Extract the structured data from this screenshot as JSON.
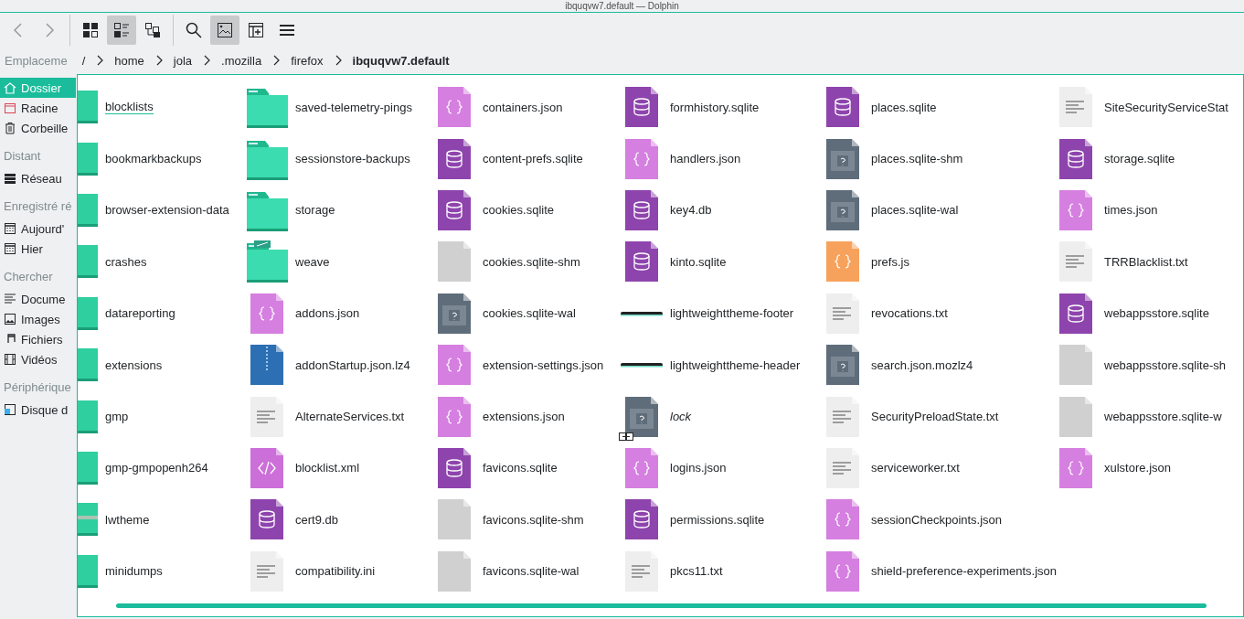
{
  "window": {
    "title": "ibquqvw7.default — Dolphin"
  },
  "toolbar": [
    {
      "kind": "back",
      "selected": false
    },
    {
      "kind": "forward",
      "selected": false
    },
    {
      "kind": "icons",
      "selected": false
    },
    {
      "kind": "compact",
      "selected": true
    },
    {
      "kind": "details",
      "selected": false
    },
    {
      "kind": "search",
      "selected": false
    },
    {
      "kind": "preview",
      "selected": true
    },
    {
      "kind": "split",
      "selected": false
    },
    {
      "kind": "menu",
      "selected": false
    }
  ],
  "breadcrumb": {
    "label": "Emplaceme",
    "parts": [
      {
        "text": "/",
        "current": false
      },
      {
        "text": "home",
        "current": false
      },
      {
        "text": "jola",
        "current": false
      },
      {
        "text": ".mozilla",
        "current": false
      },
      {
        "text": "firefox",
        "current": false
      },
      {
        "text": "ibquqvw7.default",
        "current": true
      }
    ]
  },
  "sidebar": [
    {
      "items": [
        {
          "label": "Dossier",
          "selected": true
        },
        {
          "label": "Racine",
          "selected": false
        },
        {
          "label": "Corbeille",
          "selected": false
        }
      ]
    },
    {
      "section": "Distant",
      "items": [
        {
          "label": "Réseau",
          "selected": false
        }
      ]
    },
    {
      "section": "Enregistré ré",
      "items": [
        {
          "label": "Aujourd'",
          "selected": false
        },
        {
          "label": "Hier",
          "selected": false
        }
      ]
    },
    {
      "section": "Chercher",
      "items": [
        {
          "label": "Docume",
          "selected": false
        },
        {
          "label": "Images",
          "selected": false
        },
        {
          "label": "Fichiers",
          "selected": false
        },
        {
          "label": "Vidéos",
          "selected": false
        }
      ]
    },
    {
      "section": "Périphérique",
      "items": [
        {
          "label": "Disque d",
          "selected": false
        }
      ]
    }
  ],
  "files": [
    {
      "name": "blocklists",
      "kind": "folder-cut",
      "hovered": true,
      "symlink": false
    },
    {
      "name": "bookmarkbackups",
      "kind": "folder-cut",
      "hovered": false,
      "symlink": false
    },
    {
      "name": "browser-extension-data",
      "kind": "folder-cut",
      "hovered": false,
      "symlink": false
    },
    {
      "name": "crashes",
      "kind": "folder-cut",
      "hovered": false,
      "symlink": false
    },
    {
      "name": "datareporting",
      "kind": "folder-cut",
      "hovered": false,
      "symlink": false
    },
    {
      "name": "extensions",
      "kind": "folder-cut",
      "hovered": false,
      "symlink": false
    },
    {
      "name": "gmp",
      "kind": "folder-cut",
      "hovered": false,
      "symlink": false
    },
    {
      "name": "gmp-gmpopenh264",
      "kind": "folder-cut",
      "hovered": false,
      "symlink": false
    },
    {
      "name": "lwtheme",
      "kind": "strip-folder",
      "hovered": false,
      "symlink": false
    },
    {
      "name": "minidumps",
      "kind": "folder-cut",
      "hovered": false,
      "symlink": false
    },
    {
      "name": "saved-telemetry-pings",
      "kind": "folder",
      "hovered": false,
      "symlink": false
    },
    {
      "name": "sessionstore-backups",
      "kind": "folder",
      "hovered": false,
      "symlink": false
    },
    {
      "name": "storage",
      "kind": "folder",
      "hovered": false,
      "symlink": false
    },
    {
      "name": "weave",
      "kind": "folder-emblem",
      "hovered": false,
      "symlink": false
    },
    {
      "name": "addons.json",
      "kind": "json",
      "hovered": false,
      "symlink": false
    },
    {
      "name": "addonStartup.json.lz4",
      "kind": "archive",
      "hovered": false,
      "symlink": false
    },
    {
      "name": "AlternateServices.txt",
      "kind": "text",
      "hovered": false,
      "symlink": false
    },
    {
      "name": "blocklist.xml",
      "kind": "xml",
      "hovered": false,
      "symlink": false
    },
    {
      "name": "cert9.db",
      "kind": "sqlite",
      "hovered": false,
      "symlink": false
    },
    {
      "name": "compatibility.ini",
      "kind": "text",
      "hovered": false,
      "symlink": false
    },
    {
      "name": "containers.json",
      "kind": "json",
      "hovered": false,
      "symlink": false
    },
    {
      "name": "content-prefs.sqlite",
      "kind": "sqlite",
      "hovered": false,
      "symlink": false
    },
    {
      "name": "cookies.sqlite",
      "kind": "sqlite",
      "hovered": false,
      "symlink": false
    },
    {
      "name": "cookies.sqlite-shm",
      "kind": "blank",
      "hovered": false,
      "symlink": false
    },
    {
      "name": "cookies.sqlite-wal",
      "kind": "unknown",
      "hovered": false,
      "symlink": false
    },
    {
      "name": "extension-settings.json",
      "kind": "json",
      "hovered": false,
      "symlink": false
    },
    {
      "name": "extensions.json",
      "kind": "json",
      "hovered": false,
      "symlink": false
    },
    {
      "name": "favicons.sqlite",
      "kind": "sqlite",
      "hovered": false,
      "symlink": false
    },
    {
      "name": "favicons.sqlite-shm",
      "kind": "blank",
      "hovered": false,
      "symlink": false
    },
    {
      "name": "favicons.sqlite-wal",
      "kind": "blank",
      "hovered": false,
      "symlink": false
    },
    {
      "name": "formhistory.sqlite",
      "kind": "sqlite",
      "hovered": false,
      "symlink": false
    },
    {
      "name": "handlers.json",
      "kind": "json",
      "hovered": false,
      "symlink": false
    },
    {
      "name": "key4.db",
      "kind": "sqlite",
      "hovered": false,
      "symlink": false
    },
    {
      "name": "kinto.sqlite",
      "kind": "sqlite",
      "hovered": false,
      "symlink": false
    },
    {
      "name": "lightweighttheme-footer",
      "kind": "strip",
      "hovered": false,
      "symlink": false
    },
    {
      "name": "lightweighttheme-header",
      "kind": "strip",
      "hovered": false,
      "symlink": false
    },
    {
      "name": "lock",
      "kind": "unknown",
      "hovered": false,
      "symlink": true
    },
    {
      "name": "logins.json",
      "kind": "json",
      "hovered": false,
      "symlink": false
    },
    {
      "name": "permissions.sqlite",
      "kind": "sqlite",
      "hovered": false,
      "symlink": false
    },
    {
      "name": "pkcs11.txt",
      "kind": "text",
      "hovered": false,
      "symlink": false
    },
    {
      "name": "places.sqlite",
      "kind": "sqlite",
      "hovered": false,
      "symlink": false
    },
    {
      "name": "places.sqlite-shm",
      "kind": "unknown",
      "hovered": false,
      "symlink": false
    },
    {
      "name": "places.sqlite-wal",
      "kind": "unknown",
      "hovered": false,
      "symlink": false
    },
    {
      "name": "prefs.js",
      "kind": "js",
      "hovered": false,
      "symlink": false
    },
    {
      "name": "revocations.txt",
      "kind": "text",
      "hovered": false,
      "symlink": false
    },
    {
      "name": "search.json.mozlz4",
      "kind": "unknown",
      "hovered": false,
      "symlink": false
    },
    {
      "name": "SecurityPreloadState.txt",
      "kind": "text",
      "hovered": false,
      "symlink": false
    },
    {
      "name": "serviceworker.txt",
      "kind": "text",
      "hovered": false,
      "symlink": false
    },
    {
      "name": "sessionCheckpoints.json",
      "kind": "json",
      "hovered": false,
      "symlink": false
    },
    {
      "name": "shield-preference-experiments.json",
      "kind": "json",
      "hovered": false,
      "symlink": false
    },
    {
      "name": "SiteSecurityServiceStat",
      "kind": "text",
      "hovered": false,
      "symlink": false
    },
    {
      "name": "storage.sqlite",
      "kind": "sqlite",
      "hovered": false,
      "symlink": false
    },
    {
      "name": "times.json",
      "kind": "json",
      "hovered": false,
      "symlink": false
    },
    {
      "name": "TRRBlacklist.txt",
      "kind": "text",
      "hovered": false,
      "symlink": false
    },
    {
      "name": "webappsstore.sqlite",
      "kind": "sqlite",
      "hovered": false,
      "symlink": false
    },
    {
      "name": "webappsstore.sqlite-sh",
      "kind": "blank",
      "hovered": false,
      "symlink": false
    },
    {
      "name": "webappsstore.sqlite-w",
      "kind": "blank",
      "hovered": false,
      "symlink": false
    },
    {
      "name": "xulstore.json",
      "kind": "json",
      "hovered": false,
      "symlink": false
    }
  ]
}
